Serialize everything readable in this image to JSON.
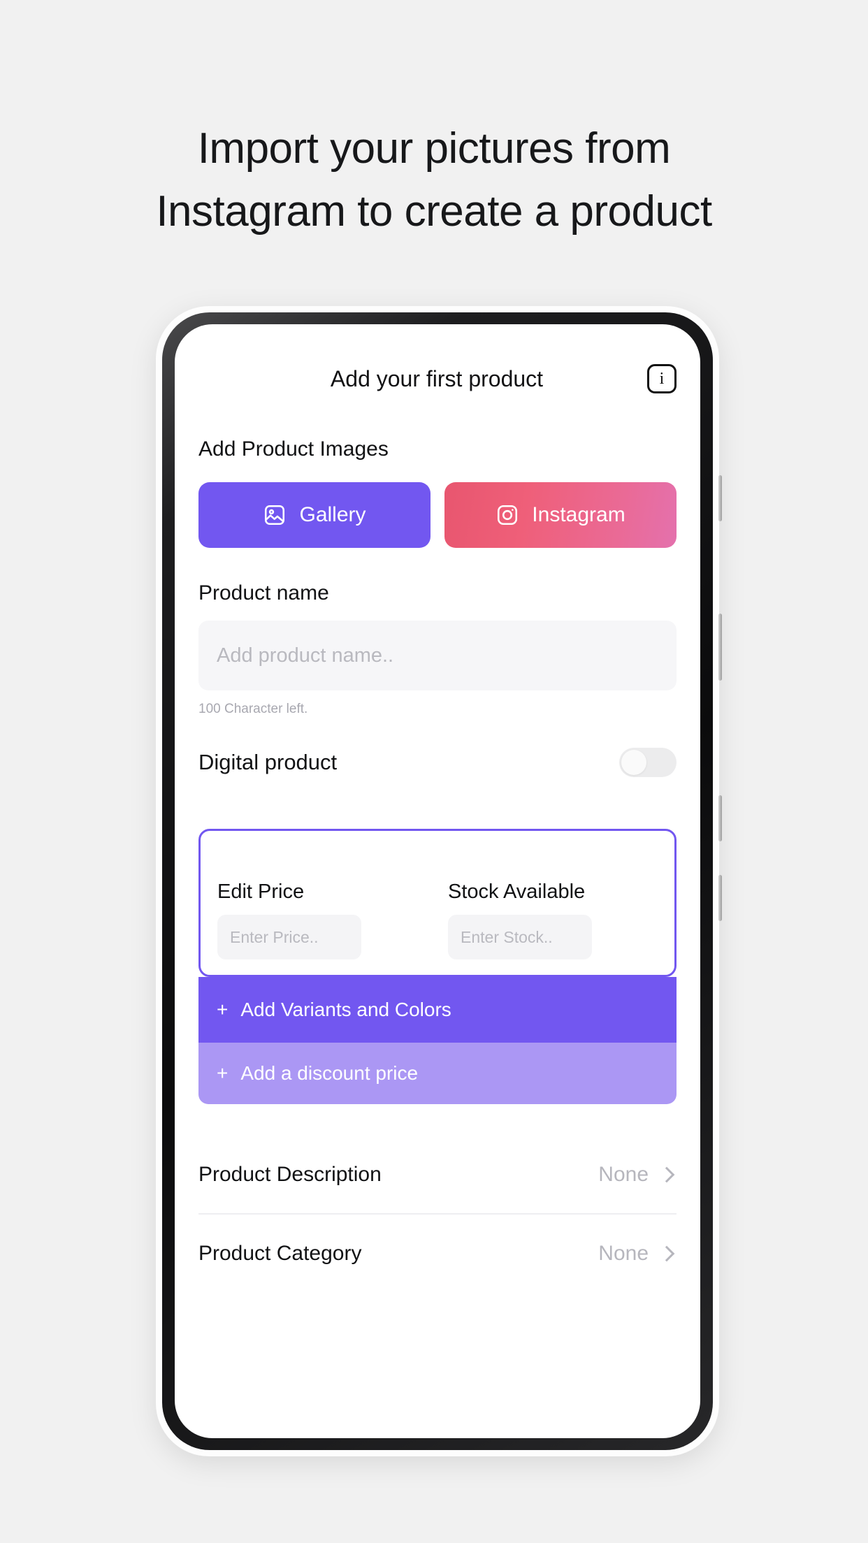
{
  "promo": {
    "line1": "Import your pictures from",
    "line2": "Instagram to create a product"
  },
  "screen": {
    "header": {
      "title": "Add your first product",
      "info_icon_label": "i"
    },
    "images_section": {
      "label": "Add Product Images",
      "buttons": [
        {
          "label": "Gallery",
          "icon": "image-icon",
          "color": "#7257f0"
        },
        {
          "label": "Instagram",
          "icon": "instagram-icon",
          "color": "#ea6a96"
        }
      ]
    },
    "product_name": {
      "label": "Product name",
      "value": "",
      "placeholder": "Add product name..",
      "helper": "100 Character left."
    },
    "digital_product": {
      "label": "Digital product",
      "state": "off"
    },
    "price_card": {
      "border_color": "#7257f0",
      "price": {
        "label": "Edit Price",
        "value": "",
        "placeholder": "Enter Price.."
      },
      "stock": {
        "label": "Stock Available",
        "value": "",
        "placeholder": "Enter Stock.."
      },
      "variants_bar": {
        "plus": "+",
        "label": "Add Variants and Colors",
        "color": "#7257f0"
      },
      "discount_bar": {
        "plus": "+",
        "label": "Add a discount price",
        "color": "#ab97f4"
      }
    },
    "detail_rows": [
      {
        "name": "Product Description",
        "value": "None",
        "chevron": "chevron-right-icon"
      },
      {
        "name": "Product Category",
        "value": "None",
        "chevron": "chevron-right-icon"
      }
    ]
  }
}
